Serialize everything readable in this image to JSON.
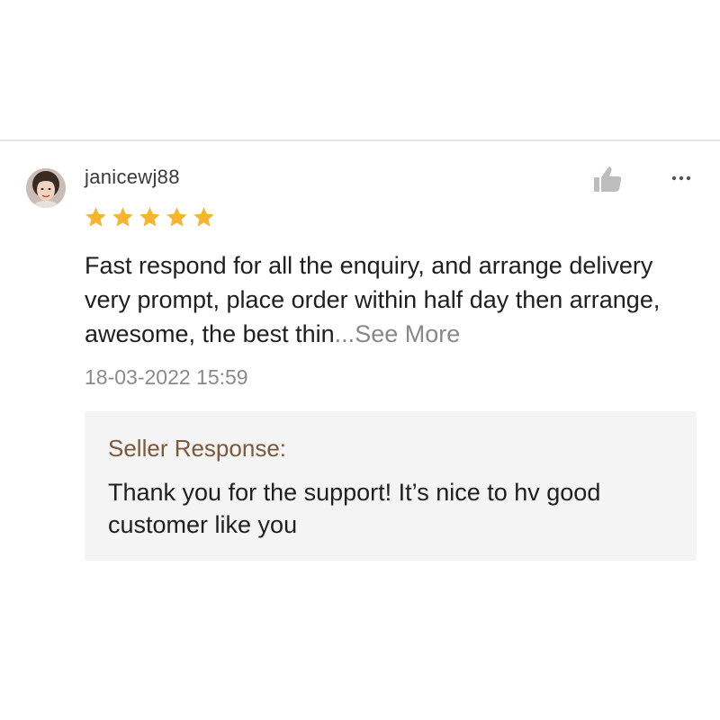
{
  "review": {
    "username": "janicewj88",
    "avatar_icon": "user-avatar-photo",
    "rating": 5,
    "rating_max": 5,
    "star_color": "#f5b52e",
    "comment_text": "Fast respond for all the enquiry, and arrange delivery very prompt, place order within half day then arrange, awesome, the best thin",
    "ellipsis": "...",
    "see_more_label": "See More",
    "timestamp": "18-03-2022 15:59",
    "like_icon": "thumbs-up-icon",
    "more_icon": "more-options-icon"
  },
  "seller_response": {
    "title": "Seller Response:",
    "text": "Thank you for the support! It’s nice to hv good customer like you",
    "title_color": "#7a5a3a",
    "background_color": "#f4f4f4"
  }
}
